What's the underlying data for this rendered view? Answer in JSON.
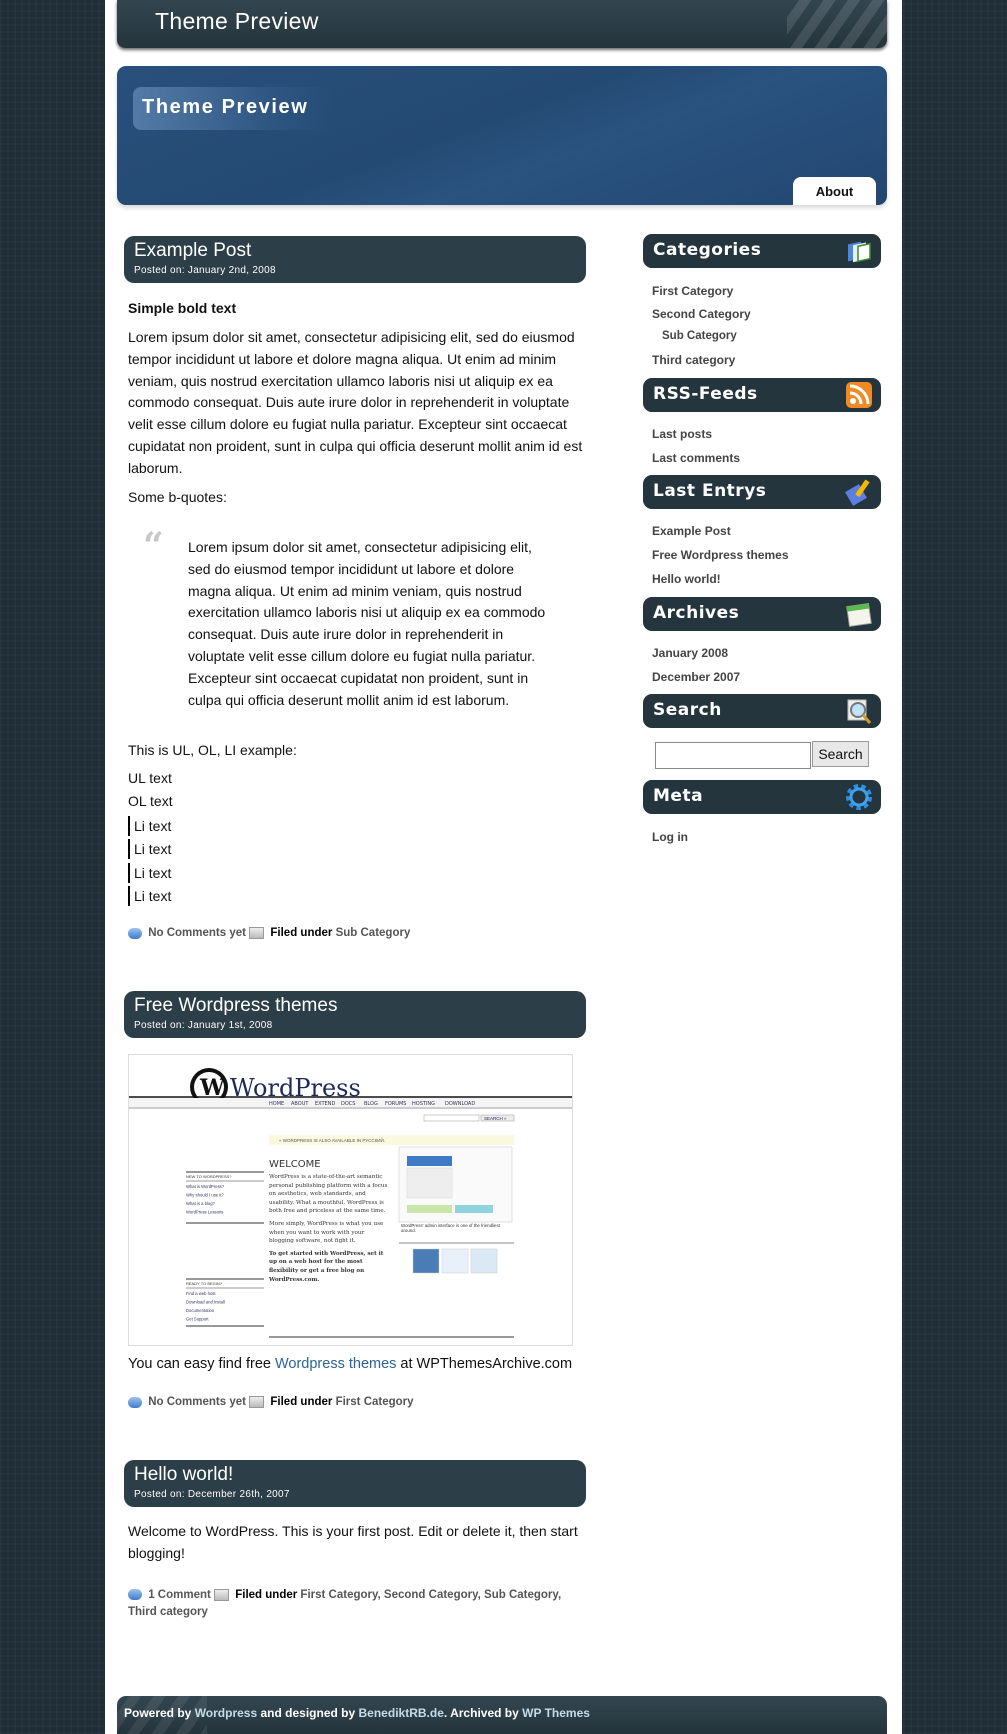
{
  "header": {
    "site_title": "Theme Preview",
    "banner_title": "Theme Preview",
    "nav": [
      {
        "label": "About"
      }
    ]
  },
  "posts": [
    {
      "title": "Example Post",
      "date": "Posted on: January 2nd, 2008",
      "bold_text": "Simple bold text",
      "paragraph": "Lorem ipsum dolor sit amet, consectetur adipisicing elit, sed do eiusmod tempor incididunt ut labore et dolore magna aliqua. Ut enim ad minim veniam, quis nostrud exercitation ullamco laboris nisi ut aliquip ex ea commodo consequat. Duis aute irure dolor in reprehenderit in voluptate velit esse cillum dolore eu fugiat nulla pariatur. Excepteur sint occaecat cupidatat non proident, sunt in culpa qui officia deserunt mollit anim id est laborum.",
      "bquote_label": "Some b-quotes:",
      "blockquote": "Lorem ipsum dolor sit amet, consectetur adipisicing elit, sed do eiusmod tempor incididunt ut labore et dolore magna aliqua. Ut enim ad minim veniam, quis nostrud exercitation ullamco laboris nisi ut aliquip ex ea commodo consequat. Duis aute irure dolor in reprehenderit in voluptate velit esse cillum dolore eu fugiat nulla pariatur. Excepteur sint occaecat cupidatat non proident, sunt in culpa qui officia deserunt mollit anim id est laborum.",
      "list_label": "This is UL, OL, LI example:",
      "ul_text": "UL text",
      "ol_text": "OL text",
      "li_items": [
        "Li text",
        "Li text",
        "Li text",
        "Li text"
      ],
      "comments": "No Comments yet",
      "filed_label": "Filed under",
      "categories": [
        "Sub Category"
      ]
    },
    {
      "title": "Free Wordpress themes",
      "date": "Posted on: January 1st, 2008",
      "image_alt": "WordPress.org homepage screenshot",
      "text_before": "You can easy find free ",
      "link_text": "Wordpress themes",
      "text_after": " at WPThemesArchive.com",
      "comments": "No Comments yet",
      "filed_label": "Filed under",
      "categories": [
        "First Category"
      ]
    },
    {
      "title": "Hello world!",
      "date": "Posted on: December 26th, 2007",
      "paragraph": "Welcome to WordPress. This is your first post. Edit or delete it, then start blogging!",
      "comments": "1 Comment",
      "filed_label": "Filed under",
      "categories": [
        "First Category",
        "Second Category",
        "Sub Category",
        "Third category"
      ]
    }
  ],
  "screenshot": {
    "logo": "WordPress",
    "nav": [
      "HOME",
      "ABOUT",
      "EXTEND",
      "DOCS",
      "BLOG",
      "FORUMS",
      "HOSTING",
      "DOWNLOAD"
    ],
    "search_btn": "SEARCH »",
    "notice": "« WORDPRESS IS ALSO AVAILABLE IN РУССКИЙ.",
    "welcome": "WELCOME",
    "new_heading": "NEW TO WORDPRESS?",
    "new_links": [
      "What is WordPress?",
      "Why should I use it?",
      "What is a blog?",
      "WordPress Lessons"
    ],
    "ready_heading": "READY TO BEGIN?",
    "ready_links": [
      "Find a web host",
      "Download and Install",
      "Documentation",
      "Get Support"
    ],
    "intro": "WordPress is a state-of-the-art semantic personal publishing platform with a focus on aesthetics, web standards, and usability. What a mouthful. WordPress is both free and priceless at the same time.",
    "simply": "More simply, WordPress is what you use when you want to work with your blogging software, not fight it.",
    "started": "To get started with WordPress, set it up on a web host for the most flexibility or get a free blog on WordPress.com.",
    "caption": "WordPress' admin interface is one of the friendliest around."
  },
  "sidebar": {
    "categories": {
      "title": "Categories",
      "items": [
        "First Category",
        "Second Category",
        "Sub Category",
        "Third category"
      ]
    },
    "rss": {
      "title": "RSS-Feeds",
      "items": [
        "Last posts",
        "Last comments"
      ]
    },
    "last_entries": {
      "title": "Last Entrys",
      "items": [
        "Example Post",
        "Free Wordpress themes",
        "Hello world!"
      ]
    },
    "archives": {
      "title": "Archives",
      "items": [
        "January 2008",
        "December 2007"
      ]
    },
    "search": {
      "title": "Search",
      "value": "",
      "button": "Search"
    },
    "meta": {
      "title": "Meta",
      "items": [
        "Log in"
      ]
    }
  },
  "footer": {
    "t1": "Powered by ",
    "l1": "Wordpress",
    "t2": " and designed by ",
    "l2": "BenediktRB.de",
    "t3": ". Archived by ",
    "l3": "WP Themes"
  },
  "colors": {
    "header_dark": "#2c3e47",
    "banner_blue": "#234a72",
    "link_blue": "#2a6496",
    "background": "#1f2e36"
  }
}
